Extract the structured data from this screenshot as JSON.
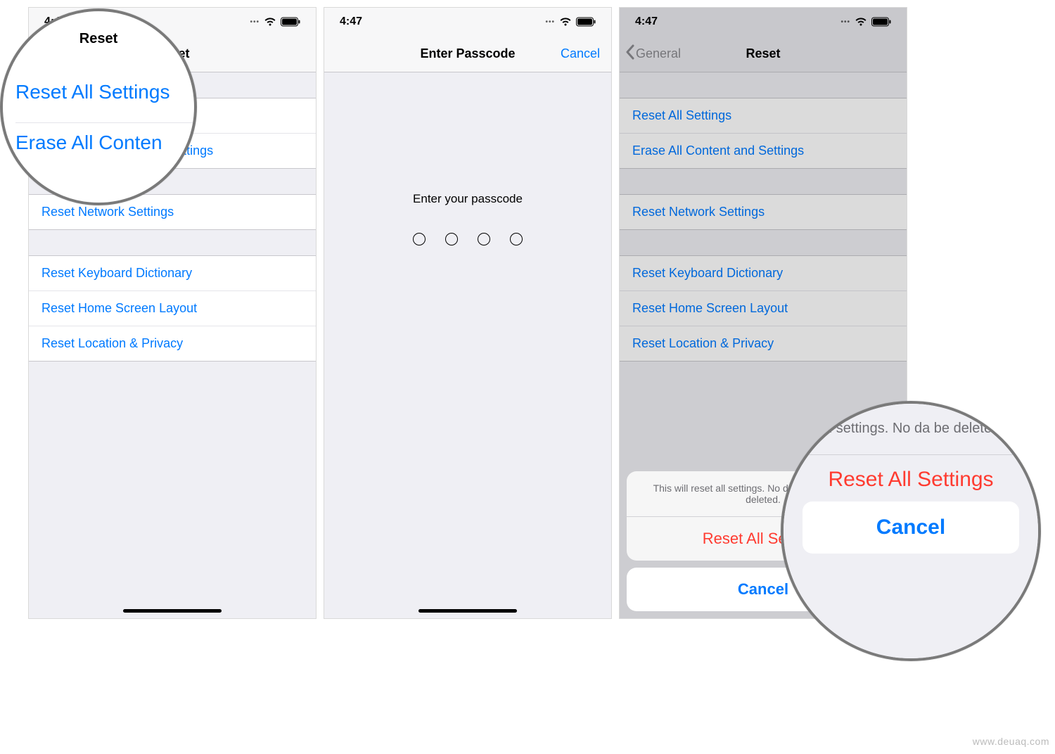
{
  "status": {
    "time": "4:47"
  },
  "phone1": {
    "nav_title": "Reset",
    "group1": [
      "Reset All Settings",
      "Erase All Content and Settings"
    ],
    "group2": [
      "Reset Network Settings"
    ],
    "group3": [
      "Reset Keyboard Dictionary",
      "Reset Home Screen Layout",
      "Reset Location & Privacy"
    ]
  },
  "phone2": {
    "nav_title": "Enter Passcode",
    "cancel": "Cancel",
    "prompt": "Enter your passcode"
  },
  "phone3": {
    "nav_title": "Reset",
    "back": "General",
    "group1": [
      "Reset All Settings",
      "Erase All Content and Settings"
    ],
    "group2": [
      "Reset Network Settings"
    ],
    "group3": [
      "Reset Keyboard Dictionary",
      "Reset Home Screen Layout",
      "Reset Location & Privacy"
    ],
    "sheet": {
      "message": "This will reset all settings. No data or media will be deleted.",
      "destructive": "Reset All Settings",
      "cancel": "Cancel"
    }
  },
  "mag1": {
    "title": "Reset",
    "line1": "Reset All Settings",
    "line2": "Erase All Conten"
  },
  "mag2": {
    "msg": "all settings. No da be deleted.",
    "reset": "Reset All Settings",
    "cancel": "Cancel"
  },
  "watermark": "www.deuaq.com"
}
